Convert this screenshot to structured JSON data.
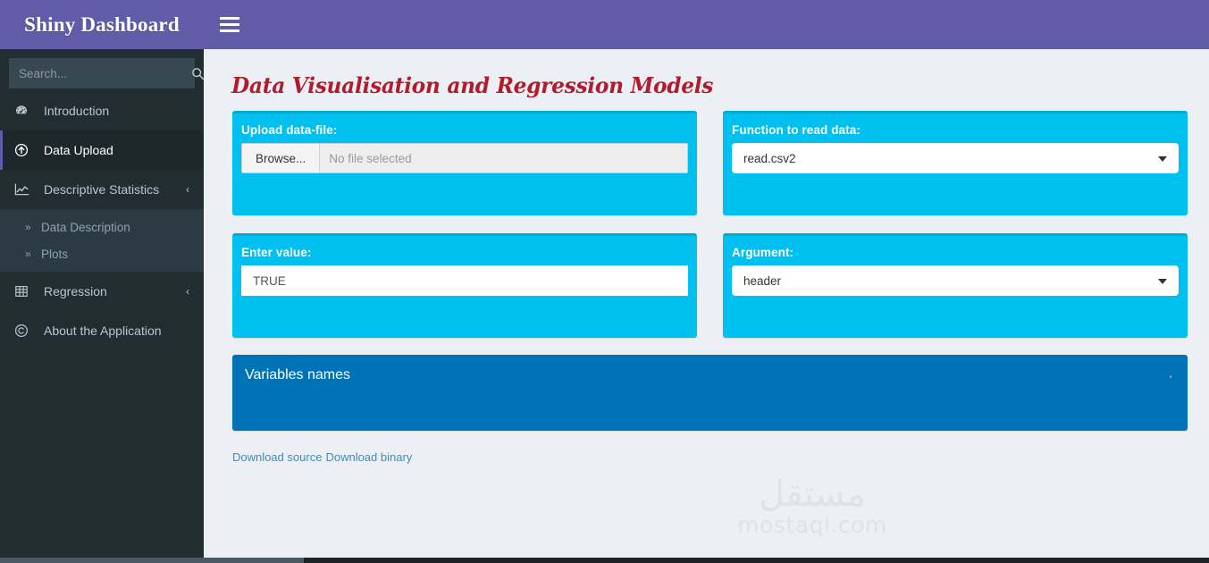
{
  "header": {
    "logo_text": "Shiny Dashboard",
    "toggle_icon": "hamburger-icon",
    "brand_color": "#605ca8"
  },
  "sidebar": {
    "search": {
      "placeholder": "Search...",
      "value": "",
      "icon": "search-icon"
    },
    "items": [
      {
        "label": "Introduction",
        "icon": "tachometer-icon",
        "active": false,
        "expandable": false
      },
      {
        "label": "Data Upload",
        "icon": "arrow-circle-up-icon",
        "active": true,
        "expandable": false
      },
      {
        "label": "Descriptive Statistics",
        "icon": "chart-line-icon",
        "active": false,
        "expandable": true,
        "arrow": "‹"
      },
      {
        "label": "Regression",
        "icon": "table-grid-icon",
        "active": false,
        "expandable": true,
        "arrow": "‹"
      },
      {
        "label": "About the Application",
        "icon": "copyright-icon",
        "active": false,
        "expandable": false
      }
    ],
    "submenu": [
      {
        "label": "Data Description",
        "icon": "angle-double-right-icon"
      },
      {
        "label": "Plots",
        "icon": "angle-double-right-icon"
      }
    ],
    "bg_color": "#222d32",
    "active_accent": "#605ca8"
  },
  "main": {
    "page_title": "Data Visualisation and Regression Models",
    "title_color": "#b01c2e",
    "accent_aqua": "#00c0ef",
    "accent_blue": "#0073b7",
    "upload_box": {
      "label": "Upload data-file:",
      "browse_label": "Browse...",
      "file_placeholder": "No file selected"
    },
    "function_box": {
      "label": "Function to read data:",
      "value": "read.csv2",
      "caret": "chevron-down-icon"
    },
    "value_box": {
      "label": "Enter value:",
      "value": "TRUE",
      "placeholder": ""
    },
    "argument_box": {
      "label": "Argument:",
      "value": "header",
      "caret": "chevron-down-icon"
    },
    "variables_box": {
      "title": "Variables names",
      "minimize_icon": "minus-icon"
    },
    "downloads": {
      "source_label": "Download source",
      "binary_label": "Download binary"
    }
  },
  "watermark": {
    "arabic": "مستقل",
    "latin": "mostaql.com"
  }
}
